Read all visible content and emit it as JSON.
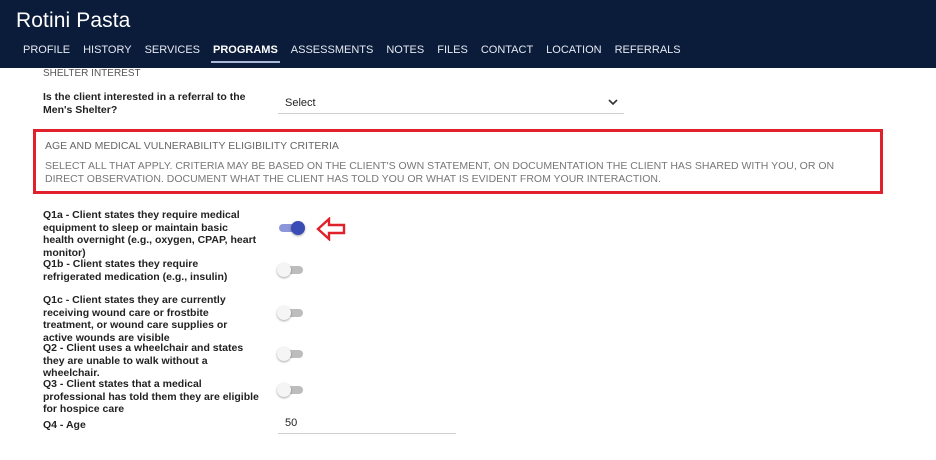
{
  "app": {
    "title": "Rotini Pasta"
  },
  "tabs": [
    {
      "label": "PROFILE"
    },
    {
      "label": "HISTORY"
    },
    {
      "label": "SERVICES"
    },
    {
      "label": "PROGRAMS",
      "active": true
    },
    {
      "label": "ASSESSMENTS"
    },
    {
      "label": "NOTES"
    },
    {
      "label": "FILES"
    },
    {
      "label": "CONTACT"
    },
    {
      "label": "LOCATION"
    },
    {
      "label": "REFERRALS"
    }
  ],
  "shelter": {
    "section_heading": "SHELTER INTEREST",
    "question": "Is the client interested in a referral to the Men's Shelter?",
    "select_value": "Select"
  },
  "criteria": {
    "title": "AGE AND MEDICAL VULNERABILITY ELIGIBILITY CRITERIA",
    "description": "SELECT ALL THAT APPLY. CRITERIA MAY BE BASED ON THE CLIENT'S OWN STATEMENT, ON DOCUMENTATION THE CLIENT HAS SHARED WITH YOU, OR ON DIRECT OBSERVATION. DOCUMENT WHAT THE CLIENT HAS TOLD YOU OR WHAT IS EVIDENT FROM YOUR INTERACTION."
  },
  "questions": [
    {
      "label": "Q1a - Client states they require medical equipment to sleep or maintain basic health overnight (e.g., oxygen, CPAP, heart monitor)",
      "checked": true
    },
    {
      "label": "Q1b - Client states they require refrigerated medication (e.g., insulin)",
      "checked": false
    },
    {
      "label": "Q1c - Client states they are currently receiving wound care or frostbite treatment, or wound care supplies or active wounds are visible",
      "checked": false
    },
    {
      "label": "Q2 - Client uses a wheelchair and states they are unable to walk without a wheelchair.",
      "checked": false
    },
    {
      "label": "Q3 - Client states that a medical professional has told them they are eligible for hospice care",
      "checked": false
    }
  ],
  "age": {
    "label": "Q4 - Age",
    "value": "50"
  },
  "colors": {
    "header_bg": "#0b1b3a",
    "highlight_border": "#e0202a",
    "toggle_on": "#3a4db5",
    "arrow": "#e0202a"
  },
  "icons": {
    "dropdown": "chevron-down-icon",
    "pointer": "arrow-left-icon"
  }
}
